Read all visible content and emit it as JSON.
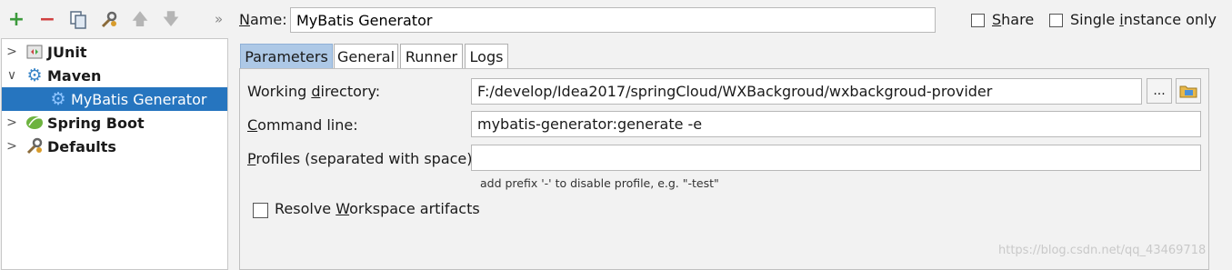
{
  "toolbar": {
    "add_icon": "plus-icon",
    "remove_icon": "minus-icon",
    "copy_icon": "copy-icon",
    "edit_defaults_icon": "wrench-icon",
    "move_up_icon": "arrow-up-icon",
    "move_down_icon": "arrow-down-icon",
    "more_label": "»"
  },
  "tree": {
    "items": [
      {
        "label": "JUnit",
        "expanded": false,
        "selected": false,
        "icon": "junit-icon"
      },
      {
        "label": "Maven",
        "expanded": true,
        "selected": false,
        "icon": "gear-icon"
      },
      {
        "label": "MyBatis Generator",
        "selected": true,
        "icon": "gear-icon"
      },
      {
        "label": "Spring Boot",
        "expanded": false,
        "selected": false,
        "icon": "spring-boot-icon"
      },
      {
        "label": "Defaults",
        "expanded": false,
        "selected": false,
        "icon": "wrench-icon"
      }
    ]
  },
  "config": {
    "name_label_prefix": "N",
    "name_label_rest": "ame:",
    "name_value": "MyBatis Generator",
    "share_prefix": "S",
    "share_rest": "hare",
    "share_checked": false,
    "single_prefix": "Single ",
    "single_u": "i",
    "single_rest": "nstance only",
    "single_checked": false
  },
  "tabs": [
    {
      "label": "Parameters",
      "active": true
    },
    {
      "label": "General",
      "active": false
    },
    {
      "label": "Runner",
      "active": false
    },
    {
      "label": "Logs",
      "active": false
    }
  ],
  "parameters": {
    "workdir_pre": "Working ",
    "workdir_u": "d",
    "workdir_post": "irectory:",
    "workdir_value": "F:/develop/Idea2017/springCloud/WXBackgroud/wxbackgroud-provider",
    "browse_label": "...",
    "cmd_u": "C",
    "cmd_post": "ommand line:",
    "cmd_value": "mybatis-generator:generate -e",
    "profiles_u": "P",
    "profiles_post": "rofiles (separated with space):",
    "profiles_value": "",
    "profiles_hint": "add prefix '-' to disable profile, e.g. \"-test\"",
    "resolve_pre": "Resolve ",
    "resolve_u": "W",
    "resolve_post": "orkspace artifacts",
    "resolve_checked": false
  },
  "colors": {
    "selection": "#2675bf",
    "active_tab": "#adc8e6",
    "add_green": "#3c9a3c",
    "remove_red": "#d04040"
  },
  "watermark": "https://blog.csdn.net/qq_43469718"
}
